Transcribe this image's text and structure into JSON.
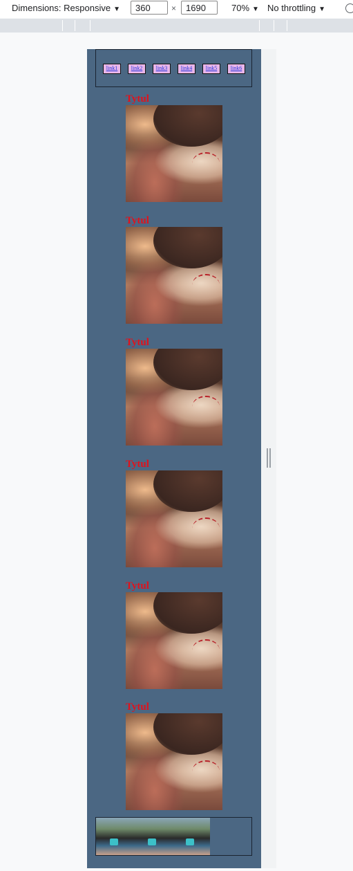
{
  "devtools": {
    "dimensions_label": "Dimensions: Responsive",
    "width_value": "360",
    "times": "×",
    "height_value": "1690",
    "zoom": "70%",
    "throttling": "No throttling",
    "caret": "▼"
  },
  "nav": {
    "links": [
      "link1",
      "link2",
      "link3",
      "link4",
      "link5",
      "link6"
    ]
  },
  "cards": [
    {
      "title": "Tytul"
    },
    {
      "title": "Tytul"
    },
    {
      "title": "Tytul"
    },
    {
      "title": "Tytul"
    },
    {
      "title": "Tytul"
    },
    {
      "title": "Tytul"
    }
  ],
  "footer": {
    "thumb_count": 3
  },
  "colors": {
    "page_background": "#4b6783",
    "title_color": "#e0121c",
    "link_background": "#e9b6e9",
    "link_text": "#2233dd"
  }
}
